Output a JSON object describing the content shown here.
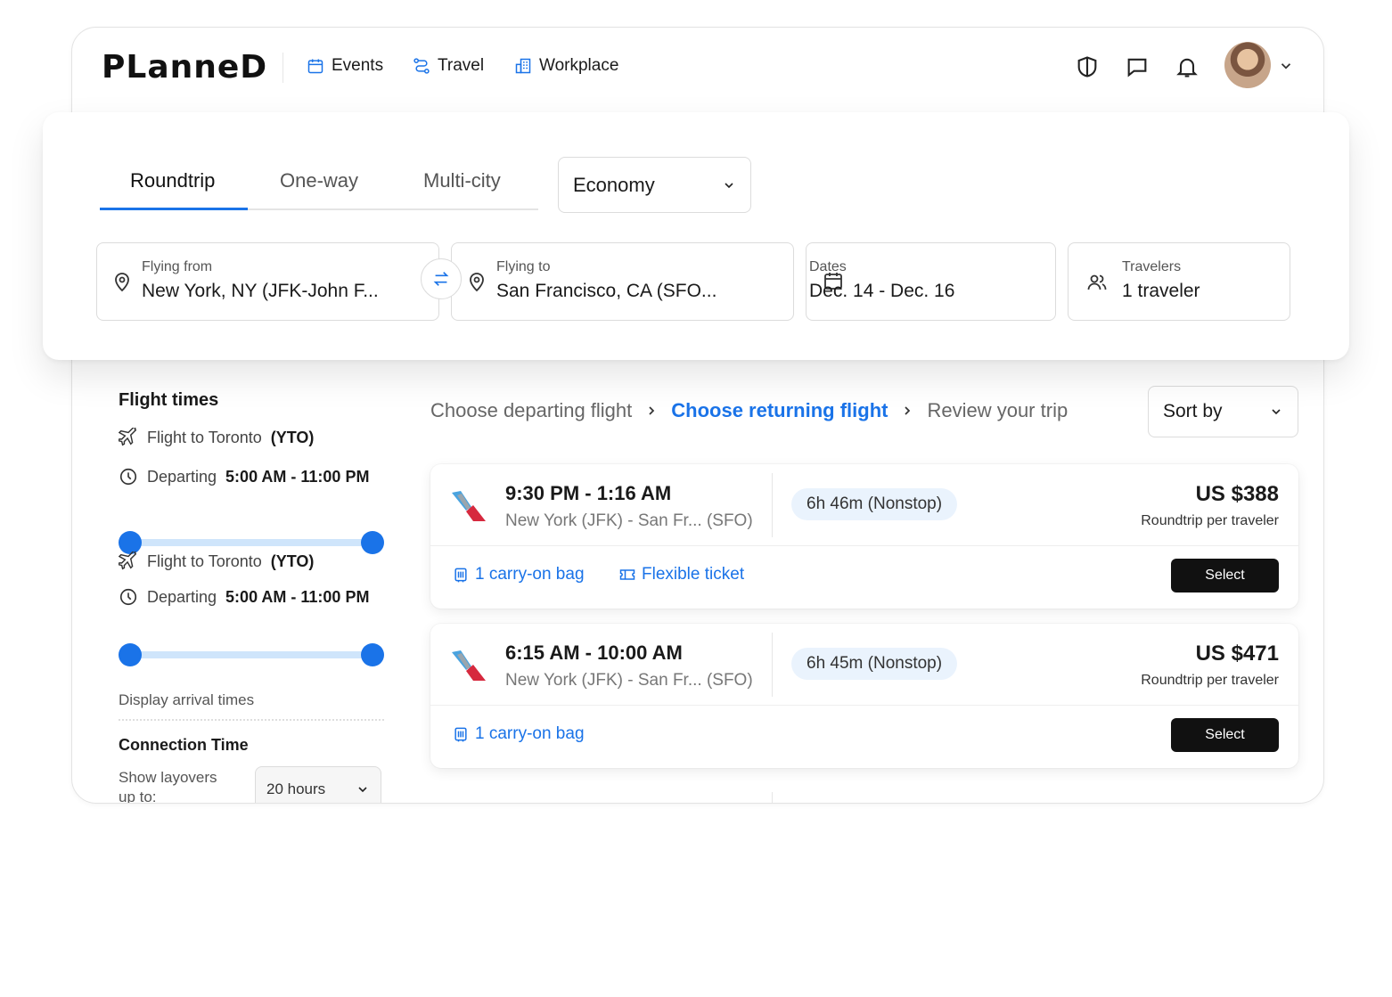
{
  "app": {
    "logo": "PLanneD"
  },
  "nav": {
    "items": [
      {
        "label": "Events",
        "icon": "calendar-icon"
      },
      {
        "label": "Travel",
        "icon": "route-icon"
      },
      {
        "label": "Workplace",
        "icon": "building-icon"
      }
    ],
    "icons": [
      "shield-icon",
      "chat-icon",
      "bell-icon"
    ],
    "accent": "#1a73e8"
  },
  "search": {
    "tabs": [
      "Roundtrip",
      "One-way",
      "Multi-city"
    ],
    "active_tab": "Roundtrip",
    "cabin": "Economy",
    "from": {
      "label": "Flying from",
      "value": "New York, NY (JFK-John F..."
    },
    "to": {
      "label": "Flying to",
      "value": "San Francisco, CA (SFO..."
    },
    "dates": {
      "label": "Dates",
      "value": "Dec. 14 - Dec. 16"
    },
    "travelers": {
      "label": "Travelers",
      "value": "1 traveler"
    }
  },
  "filters": {
    "title": "Flight times",
    "groups": [
      {
        "flight_prefix": "Flight to Toronto",
        "flight_code": "(YTO)",
        "dep_prefix": "Departing",
        "dep_range": "5:00 AM - 11:00 PM"
      },
      {
        "flight_prefix": "Flight to Toronto",
        "flight_code": "(YTO)",
        "dep_prefix": "Departing",
        "dep_range": "5:00 AM - 11:00 PM"
      }
    ],
    "arrival_link": "Display arrival times",
    "connection_title": "Connection Time",
    "layover_label": "Show layovers up to:",
    "layover_value": "20 hours"
  },
  "breadcrumb": {
    "steps": [
      "Choose departing flight",
      "Choose returning flight",
      "Review your trip"
    ],
    "active": "Choose returning flight"
  },
  "sort": {
    "label": "Sort by"
  },
  "flights": [
    {
      "time": "9:30 PM - 1:16 AM",
      "route": "New York (JFK) - San Fr... (SFO)",
      "duration": "6h 46m (Nonstop)",
      "price": "US $388",
      "price_note": "Roundtrip per traveler",
      "perks": [
        "1 carry-on bag",
        "Flexible ticket"
      ],
      "button": "Select"
    },
    {
      "time": "6:15 AM - 10:00 AM",
      "route": "New York (JFK) - San Fr... (SFO)",
      "duration": "6h 45m (Nonstop)",
      "price": "US $471",
      "price_note": "Roundtrip per traveler",
      "perks": [
        "1 carry-on bag"
      ],
      "button": "Select"
    }
  ]
}
